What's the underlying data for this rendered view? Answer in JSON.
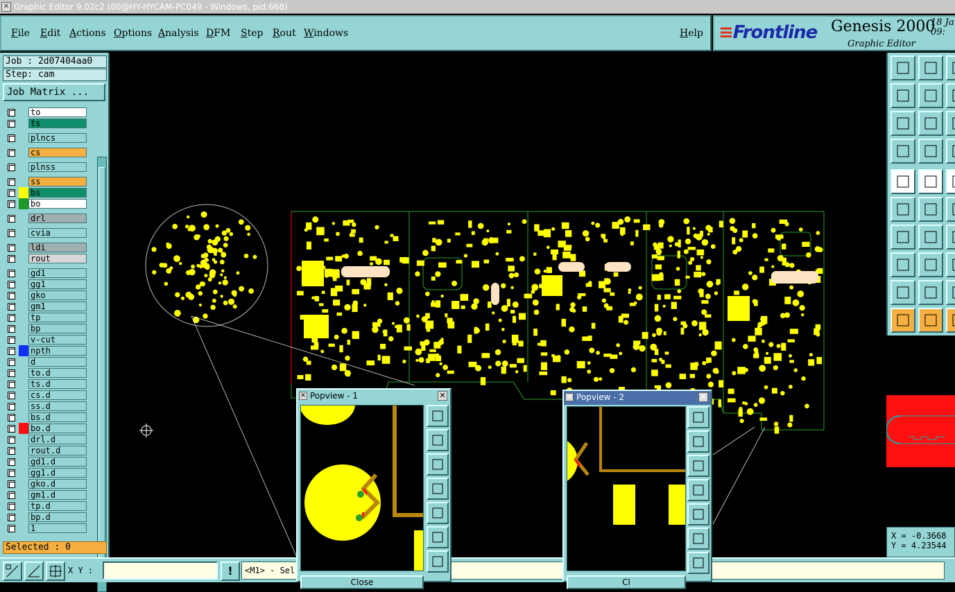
{
  "window": {
    "title": "Graphic Editor 9.02c2 (00@HY-HYCAM-PC049 - Windows, pid:668)"
  },
  "menu": {
    "file": "File",
    "edit": "Edit",
    "actions": "Actions",
    "options": "Options",
    "analysis": "Analysis",
    "dfm": "DFM",
    "step": "Step",
    "rout": "Rout",
    "windows": "Windows",
    "help": "Help"
  },
  "brand": {
    "logo": "Frontline",
    "product": "Genesis 2000",
    "subtitle": "Graphic Editor",
    "date_line1": "18 Ja",
    "date_line2": "09:"
  },
  "job": {
    "job_label": "Job : 2d07404aa0",
    "step_label": "Step: cam",
    "matrix_button": "Job Matrix ..."
  },
  "layers": [
    {
      "name": "to",
      "color": "#ffffff",
      "swatch": ""
    },
    {
      "name": "ts",
      "color": "#0f8f6a",
      "swatch": ""
    },
    {
      "name": "plncs",
      "color": "#95d5d5",
      "swatch": ""
    },
    {
      "name": "cs",
      "color": "#f5b041",
      "swatch": ""
    },
    {
      "name": "plnss",
      "color": "#95d5d5",
      "swatch": ""
    },
    {
      "name": "ss",
      "color": "#f5b041",
      "swatch": ""
    },
    {
      "name": "bs",
      "color": "#0f8f6a",
      "swatch": "#ffff00"
    },
    {
      "name": "bo",
      "color": "#ffffff",
      "swatch": "#1f9a2a"
    },
    {
      "name": "drl",
      "color": "#a0b0b0",
      "swatch": ""
    },
    {
      "name": "cvia",
      "color": "#95d5d5",
      "swatch": ""
    },
    {
      "name": "ldi",
      "color": "#a0b0b0",
      "swatch": ""
    },
    {
      "name": "rout",
      "color": "#d8d8d8",
      "swatch": ""
    },
    {
      "name": "gd1",
      "color": "#95d5d5",
      "swatch": ""
    },
    {
      "name": "gg1",
      "color": "#95d5d5",
      "swatch": ""
    },
    {
      "name": "gko",
      "color": "#95d5d5",
      "swatch": ""
    },
    {
      "name": "gm1",
      "color": "#95d5d5",
      "swatch": ""
    },
    {
      "name": "tp",
      "color": "#95d5d5",
      "swatch": ""
    },
    {
      "name": "bp",
      "color": "#95d5d5",
      "swatch": ""
    },
    {
      "name": "v-cut",
      "color": "#95d5d5",
      "swatch": ""
    },
    {
      "name": "npth",
      "color": "#95d5d5",
      "swatch": "#1030ff"
    },
    {
      "name": "d",
      "color": "#95d5d5",
      "swatch": ""
    },
    {
      "name": "to.d",
      "color": "#95d5d5",
      "swatch": ""
    },
    {
      "name": "ts.d",
      "color": "#95d5d5",
      "swatch": ""
    },
    {
      "name": "cs.d",
      "color": "#95d5d5",
      "swatch": ""
    },
    {
      "name": "ss.d",
      "color": "#95d5d5",
      "swatch": ""
    },
    {
      "name": "bs.d",
      "color": "#95d5d5",
      "swatch": ""
    },
    {
      "name": "bo.d",
      "color": "#95d5d5",
      "swatch": "#ff1010"
    },
    {
      "name": "drl.d",
      "color": "#95d5d5",
      "swatch": ""
    },
    {
      "name": "rout.d",
      "color": "#95d5d5",
      "swatch": ""
    },
    {
      "name": "gd1.d",
      "color": "#95d5d5",
      "swatch": ""
    },
    {
      "name": "gg1.d",
      "color": "#95d5d5",
      "swatch": ""
    },
    {
      "name": "gko.d",
      "color": "#95d5d5",
      "swatch": ""
    },
    {
      "name": "gm1.d",
      "color": "#95d5d5",
      "swatch": ""
    },
    {
      "name": "tp.d",
      "color": "#95d5d5",
      "swatch": ""
    },
    {
      "name": "bp.d",
      "color": "#95d5d5",
      "swatch": ""
    },
    {
      "name": "1",
      "color": "#95d5d5",
      "swatch": ""
    }
  ],
  "status": {
    "selected": "Selected : 0",
    "xy_label": "X Y :",
    "xy_value": "",
    "message": "<M1> - Sel"
  },
  "coords": {
    "x": "X = -0.3668",
    "y": "Y = 4.23544"
  },
  "popview1": {
    "title": "Popview - 1",
    "close_label": "Close"
  },
  "popview2": {
    "title": "Popview - 2",
    "close_label": "Cl"
  },
  "colors": {
    "pad": "#ffff00",
    "trace": "#b8860b",
    "profile": "#2aa02a",
    "accent_red": "#ff1010",
    "bg": "#000000"
  }
}
